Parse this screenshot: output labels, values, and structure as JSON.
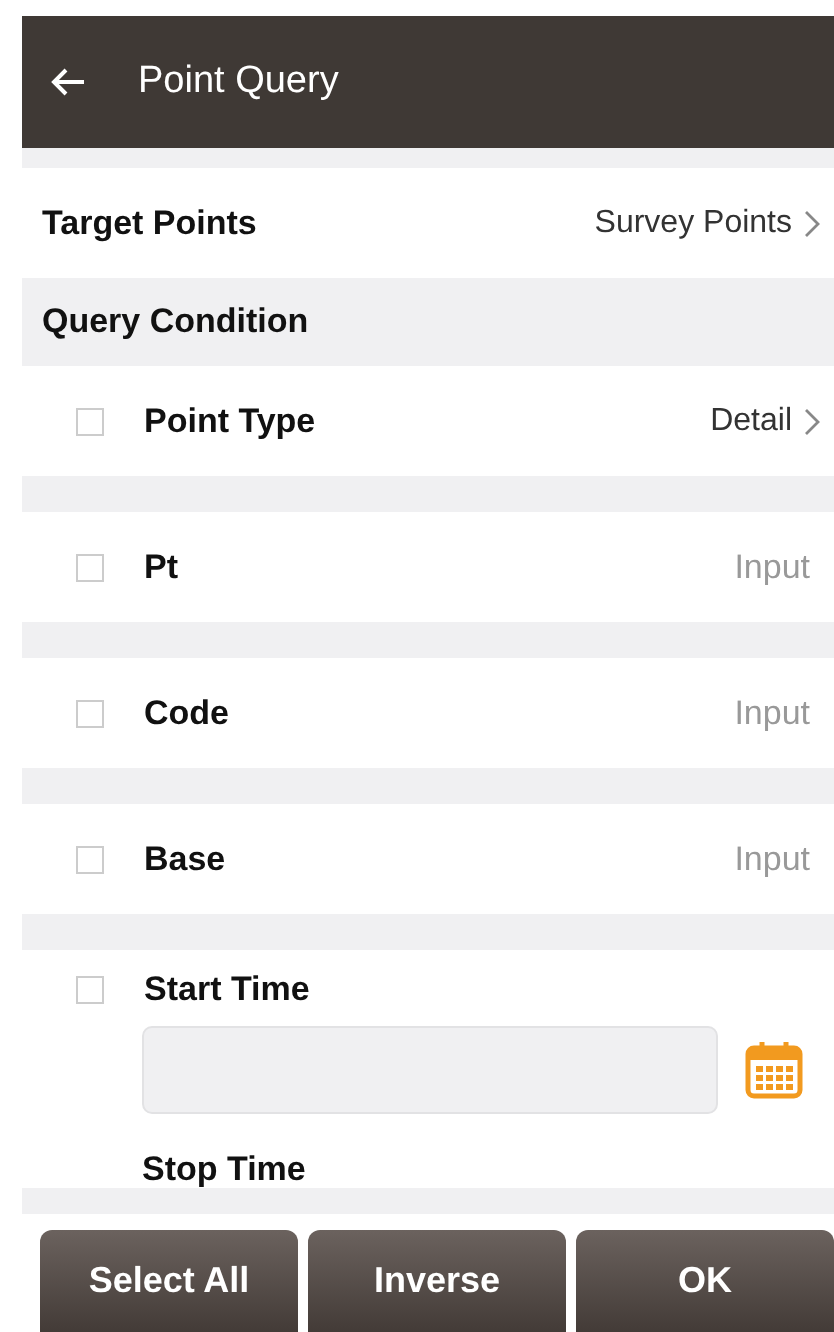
{
  "header": {
    "title": "Point Query"
  },
  "target": {
    "label": "Target Points",
    "value": "Survey Points"
  },
  "query": {
    "heading": "Query Condition",
    "conditions": [
      {
        "kind": "select",
        "label": "Point Type",
        "value": "Detail",
        "checked": false
      },
      {
        "kind": "input",
        "label": "Pt",
        "placeholder": "Input",
        "checked": false
      },
      {
        "kind": "input",
        "label": "Code",
        "placeholder": "Input",
        "checked": false
      },
      {
        "kind": "input",
        "label": "Base",
        "placeholder": "Input",
        "checked": false
      },
      {
        "kind": "time",
        "label": "Start Time",
        "checked": false,
        "next_label": "Stop Time"
      }
    ]
  },
  "buttons": [
    "Select All",
    "Inverse",
    "OK"
  ]
}
